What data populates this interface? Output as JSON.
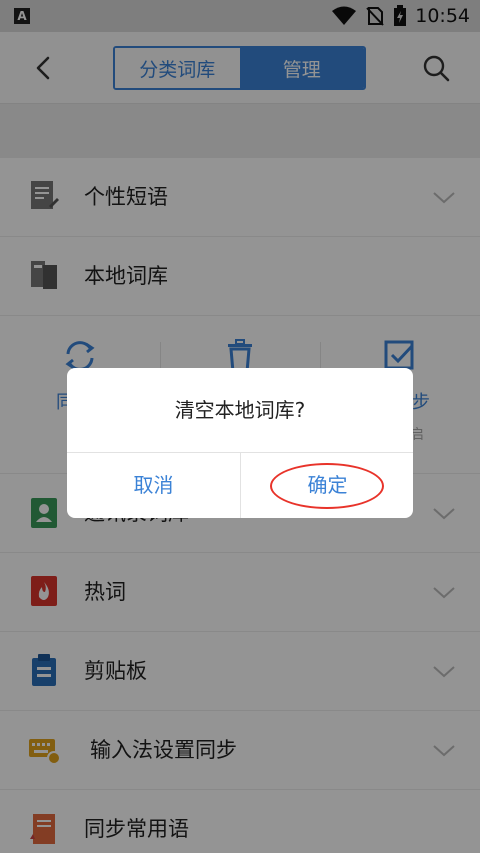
{
  "status_bar": {
    "time": "10:54",
    "app_badge": "A",
    "icons": [
      "wifi-icon",
      "no-sim-icon",
      "battery-charging-icon"
    ]
  },
  "header": {
    "tabs": [
      {
        "label": "分类词库",
        "active": false
      },
      {
        "label": "管理",
        "active": true
      }
    ],
    "accent_color": "#3b82d6"
  },
  "list": {
    "personal_phrases": "个性短语",
    "local_lexicon": "本地词库",
    "contacts_lexicon": "通讯录词库",
    "hot_words": "热词",
    "clipboard": "剪贴板",
    "ime_settings_sync": "输入法设置同步",
    "sync_common_phrases": "同步常用语"
  },
  "tools": {
    "left_label": "同",
    "right_label": "步",
    "right_sub": "启"
  },
  "dialog": {
    "message": "清空本地词库?",
    "cancel_label": "取消",
    "confirm_label": "确定",
    "highlight_color": "#e8332a"
  }
}
